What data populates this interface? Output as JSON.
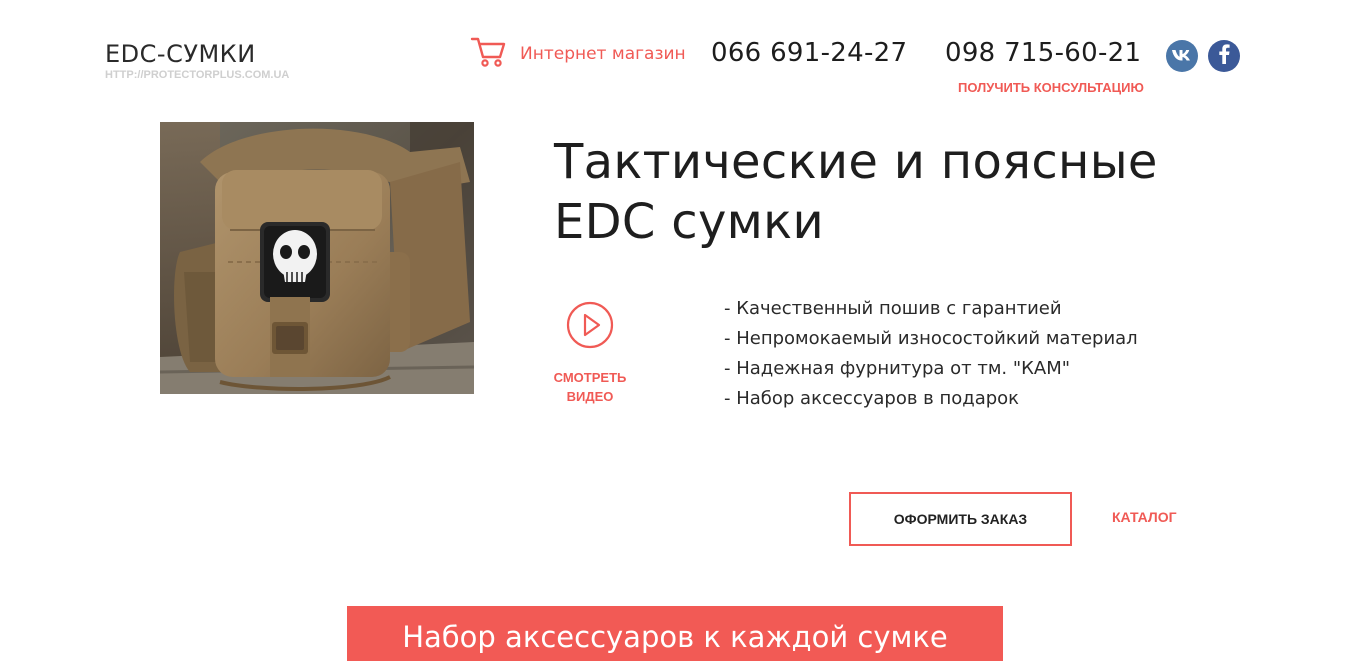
{
  "header": {
    "logo_title": "EDC-СУМКИ",
    "logo_url": "HTTP://PROTECTORPLUS.COM.UA",
    "shop_link_label": "Интернет магазин",
    "phones": [
      "066 691-24-27",
      "098 715-60-21"
    ],
    "consult_label": "ПОЛУЧИТЬ КОНСУЛЬТАЦИЮ",
    "social": {
      "vk_label": "vk",
      "vk_icon": "vk-icon",
      "facebook_label": "f",
      "facebook_icon": "facebook-icon"
    }
  },
  "hero": {
    "image_icon": "product-photo-tactical-bag",
    "headline_line1": "Тактические и поясные",
    "headline_line2": "EDC сумки",
    "video_label_line1": "СМОТРЕТЬ",
    "video_label_line2": "ВИДЕО",
    "features": [
      "- Качественный пошив с гарантией",
      "- Непромокаемый износостойкий материал",
      "- Надежная фурнитура от тм. \"КАМ\"",
      "- Набор аксессуаров в подарок"
    ],
    "order_button_label": "ОФОРМИТЬ ЗАКАЗ",
    "catalog_label": "КАТАЛОГ"
  },
  "banner": {
    "text": "Набор аксессуаров к каждой сумке"
  },
  "colors": {
    "accent": "#f05a55",
    "banner_bg": "#f25a55",
    "vk_bg": "#4a76a8",
    "facebook_bg": "#3b5998"
  }
}
